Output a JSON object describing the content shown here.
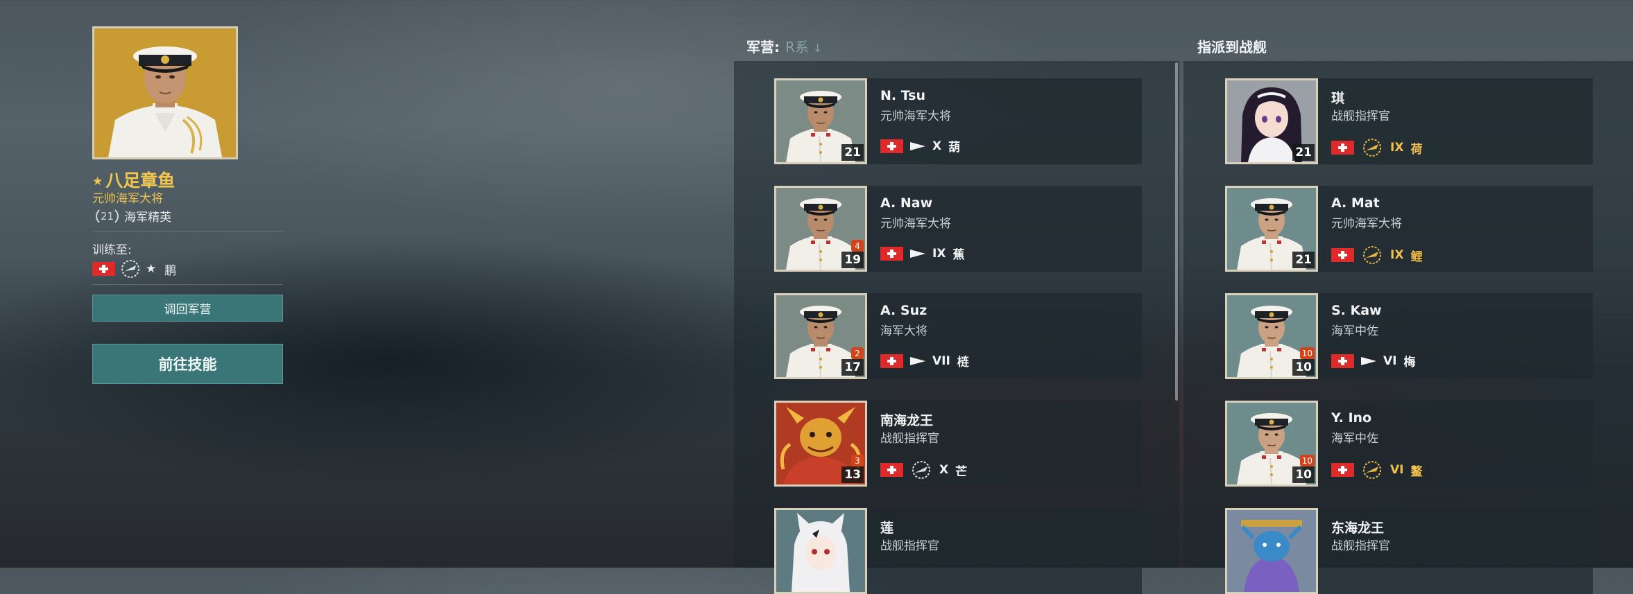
{
  "commander": {
    "name": "八足章鱼",
    "rank": "元帅海军大将",
    "elite_level": "21",
    "elite_label": "海军精英",
    "trained_for_label": "训练至:",
    "trained_ship": "鹏",
    "recall_button": "调回军营",
    "skills_button": "前往技能"
  },
  "barracks": {
    "label": "军营:",
    "sort": "R系",
    "sort_arrow": "↓",
    "cards": [
      {
        "name": "N. Tsu",
        "rank": "元帅海军大将",
        "level": "21",
        "points": "",
        "tier": "X",
        "ship": "葫",
        "premium": false,
        "portrait": "officer"
      },
      {
        "name": "A. Naw",
        "rank": "元帅海军大将",
        "level": "19",
        "points": "4",
        "tier": "IX",
        "ship": "蕉",
        "premium": false,
        "portrait": "officer"
      },
      {
        "name": "A. Suz",
        "rank": "海军大将",
        "level": "17",
        "points": "2",
        "tier": "VII",
        "ship": "梿",
        "premium": false,
        "portrait": "officer"
      },
      {
        "name": "南海龙王",
        "rank": "战舰指挥官",
        "level": "13",
        "points": "3",
        "tier": "X",
        "ship": "芒",
        "premium": false,
        "laurel": true,
        "portrait": "dragon"
      },
      {
        "name": "莲",
        "rank": "战舰指挥官",
        "level": "",
        "points": "",
        "tier": "",
        "ship": "",
        "premium": false,
        "portrait": "catgirl"
      }
    ]
  },
  "assign": {
    "label": "指派到战舰",
    "cards": [
      {
        "name": "琪",
        "rank": "战舰指挥官",
        "level": "21",
        "points": "",
        "tier": "IX",
        "ship": "荷",
        "premium": true,
        "portrait": "anime"
      },
      {
        "name": "A. Mat",
        "rank": "元帅海军大将",
        "level": "21",
        "points": "",
        "tier": "IX",
        "ship": "鲤",
        "premium": true,
        "portrait": "officer2"
      },
      {
        "name": "S. Kaw",
        "rank": "海军中佐",
        "level": "10",
        "points": "10",
        "tier": "VI",
        "ship": "梅",
        "premium": false,
        "portrait": "officer2"
      },
      {
        "name": "Y. Ino",
        "rank": "海军中佐",
        "level": "10",
        "points": "10",
        "tier": "VI",
        "ship": "鳌",
        "premium": true,
        "portrait": "officer2"
      },
      {
        "name": "东海龙王",
        "rank": "战舰指挥官",
        "level": "",
        "points": "",
        "tier": "",
        "ship": "",
        "premium": false,
        "portrait": "bluedragon"
      }
    ]
  },
  "colors": {
    "accent_gold": "#f3c64c",
    "button_teal": "#3a7677",
    "flag_red": "#e02a2a",
    "points_badge": "#d2431c"
  },
  "icons": [
    "star-icon",
    "laurel-icon",
    "flag-icon",
    "pennant-icon",
    "sort-arrow-icon"
  ]
}
